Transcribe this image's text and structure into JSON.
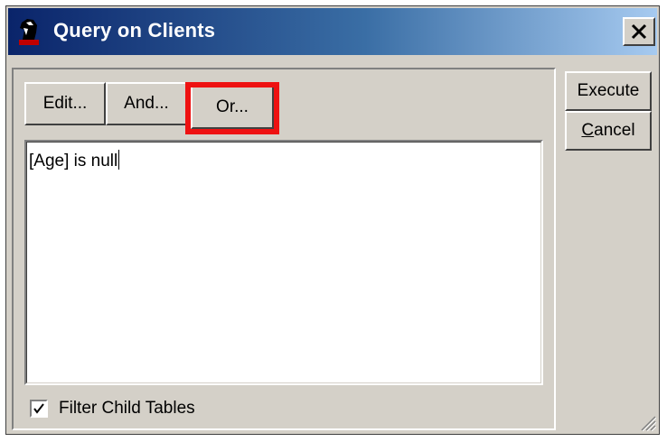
{
  "window": {
    "title": "Query on Clients",
    "close_label": "X"
  },
  "toolbar": {
    "edit_label": "Edit...",
    "and_label": "And...",
    "or_label": "Or..."
  },
  "editor": {
    "query_text": "[Age] is null"
  },
  "actions": {
    "execute_label": "Execute",
    "cancel_label_first": "C",
    "cancel_label_rest": "ancel"
  },
  "options": {
    "filter_child_tables_label": "Filter Child Tables",
    "filter_child_tables_checked": true
  },
  "colors": {
    "highlight": "#ee1111",
    "title_gradient_start": "#0a246a",
    "title_gradient_end": "#a6caf0"
  },
  "icons": [
    "app-chess-knight-icon",
    "close-icon",
    "checkmark-icon",
    "resize-grip-icon"
  ]
}
